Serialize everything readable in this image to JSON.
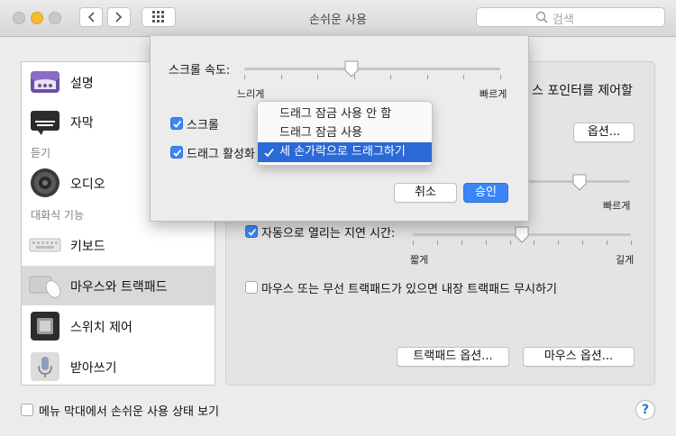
{
  "window": {
    "title": "손쉬운 사용"
  },
  "search": {
    "placeholder": "검색"
  },
  "sidebar": {
    "items": [
      {
        "label": "설명",
        "icon": "description-icon"
      },
      {
        "label": "자막",
        "icon": "captions-icon"
      },
      {
        "label": "오디오",
        "icon": "speaker-icon"
      },
      {
        "label": "키보드",
        "icon": "keyboard-icon"
      },
      {
        "label": "마우스와 트랙패드",
        "icon": "mouse-trackpad-icon",
        "selected": true
      },
      {
        "label": "스위치 제어",
        "icon": "switch-control-icon"
      },
      {
        "label": "받아쓰기",
        "icon": "microphone-icon"
      }
    ],
    "headers": [
      "듣기",
      "대화식 기능"
    ]
  },
  "main": {
    "pointer_text": "스 포인터를 제어할",
    "options_button": "옵션...",
    "speed_fast": "빠르게",
    "spring_checkbox_label": "자동으로 열리는 지연 시간:",
    "spring_checked": true,
    "spring_short": "짧게",
    "spring_long": "길게",
    "spring_value": 0.5,
    "ignore_trackpad_label": "마우스 또는 무선 트랙패드가 있으면 내장 트랙패드 무시하기",
    "ignore_trackpad_checked": false,
    "trackpad_options_button": "트랙패드 옵션...",
    "mouse_options_button": "마우스 옵션..."
  },
  "sheet": {
    "scroll_speed_label": "스크롤 속도:",
    "scroll_slow": "느리게",
    "scroll_fast": "빠르게",
    "scroll_speed_value": 0.42,
    "scroll_checkbox_label": "스크롤",
    "scroll_checked": true,
    "drag_checkbox_label": "드래그 활성화",
    "drag_checked": true,
    "cancel_button": "취소",
    "ok_button": "승인"
  },
  "drag_menu": {
    "options": [
      "드래그 잠금 사용 안 함",
      "드래그 잠금 사용",
      "세 손가락으로 드래그하기"
    ],
    "selected_index": 2
  },
  "footer": {
    "show_status_label": "메뉴 막대에서 손쉬운 사용 상태 보기",
    "show_status_checked": false,
    "help_label": "?"
  },
  "colors": {
    "accent": "#3b86f7",
    "menu_highlight": "#2b69d6"
  }
}
